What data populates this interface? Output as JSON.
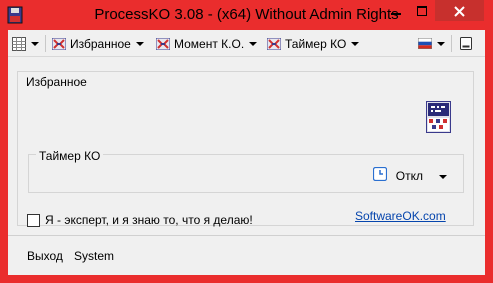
{
  "window": {
    "title": "ProcessKO 3.08 - (x64) Without Admin Rights",
    "accent": "#ea2d2d",
    "close_button_color": "#c7302d"
  },
  "toolbar": {
    "grid_icon": "grid-icon",
    "favorites_label": "Избранное",
    "moment_label": "Момент К.О.",
    "timer_label": "Таймер КО",
    "flag_icon": "flag-icon",
    "minimize_icon": "tray-minimize-icon"
  },
  "main": {
    "favorites_heading": "Избранное",
    "app_icon": "processko-icon",
    "timer_group_label": "Таймер КО",
    "timer_icon": "clock-icon",
    "timer_value": "Откл",
    "expert_checkbox": {
      "label": "Я - эксперт, и я знаю то, что я делаю!",
      "checked": false
    },
    "link": "SoftwareOK.com"
  },
  "bottom": {
    "exit_label": "Выход",
    "system_label": "System"
  }
}
